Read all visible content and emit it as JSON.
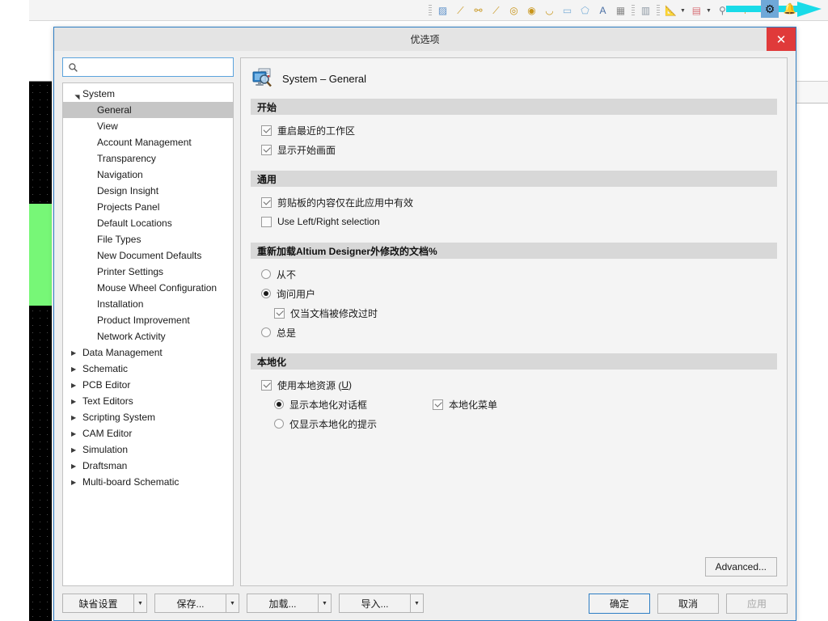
{
  "background": {
    "toolbar_icons": [
      {
        "name": "grip-handle",
        "glyph": ""
      },
      {
        "name": "polygon-pour-icon",
        "glyph": "▨"
      },
      {
        "name": "place-line-icon",
        "glyph": "⟋"
      },
      {
        "name": "place-net-icon",
        "glyph": "⚯"
      },
      {
        "name": "place-route-icon",
        "glyph": "⟋"
      },
      {
        "name": "place-pad-icon",
        "glyph": "◎"
      },
      {
        "name": "place-via-icon",
        "glyph": "◉"
      },
      {
        "name": "place-arc-icon",
        "glyph": "◡"
      },
      {
        "name": "place-rectangle-icon",
        "glyph": "▭"
      },
      {
        "name": "place-polygon-icon",
        "glyph": "⬠"
      },
      {
        "name": "place-string-icon",
        "glyph": "A"
      },
      {
        "name": "place-component-icon",
        "glyph": "▦"
      },
      {
        "name": "grip-handle-2",
        "glyph": ""
      },
      {
        "name": "design-rule-check-icon",
        "glyph": "📐"
      },
      {
        "name": "layer-stack-icon",
        "glyph": "▤"
      },
      {
        "name": "find-similar-icon",
        "glyph": "⚲"
      },
      {
        "name": "dimension-icon",
        "glyph": "⊢"
      },
      {
        "name": "board-planning-icon",
        "glyph": "⧉"
      }
    ],
    "gear_button": "gear-icon",
    "notification_button": "bell-icon",
    "annotation_arrow": "cyan-arrow-pointing-at-gear"
  },
  "dialog": {
    "title": "优选项",
    "close_label": "✕",
    "search": {
      "value": "",
      "placeholder": ""
    },
    "tree": [
      {
        "label": "System",
        "level": 0,
        "twisty": "expanded",
        "selected": false
      },
      {
        "label": "General",
        "level": 1,
        "twisty": "none",
        "selected": true
      },
      {
        "label": "View",
        "level": 1,
        "twisty": "none",
        "selected": false
      },
      {
        "label": "Account Management",
        "level": 1,
        "twisty": "none",
        "selected": false
      },
      {
        "label": "Transparency",
        "level": 1,
        "twisty": "none",
        "selected": false
      },
      {
        "label": "Navigation",
        "level": 1,
        "twisty": "none",
        "selected": false
      },
      {
        "label": "Design Insight",
        "level": 1,
        "twisty": "none",
        "selected": false
      },
      {
        "label": "Projects Panel",
        "level": 1,
        "twisty": "none",
        "selected": false
      },
      {
        "label": "Default Locations",
        "level": 1,
        "twisty": "none",
        "selected": false
      },
      {
        "label": "File Types",
        "level": 1,
        "twisty": "none",
        "selected": false
      },
      {
        "label": "New Document Defaults",
        "level": 1,
        "twisty": "none",
        "selected": false
      },
      {
        "label": "Printer Settings",
        "level": 1,
        "twisty": "none",
        "selected": false
      },
      {
        "label": "Mouse Wheel Configuration",
        "level": 1,
        "twisty": "none",
        "selected": false
      },
      {
        "label": "Installation",
        "level": 1,
        "twisty": "none",
        "selected": false
      },
      {
        "label": "Product Improvement",
        "level": 1,
        "twisty": "none",
        "selected": false
      },
      {
        "label": "Network Activity",
        "level": 1,
        "twisty": "none",
        "selected": false
      },
      {
        "label": "Data Management",
        "level": 0,
        "twisty": "collapsed",
        "selected": false
      },
      {
        "label": "Schematic",
        "level": 0,
        "twisty": "collapsed",
        "selected": false
      },
      {
        "label": "PCB Editor",
        "level": 0,
        "twisty": "collapsed",
        "selected": false
      },
      {
        "label": "Text Editors",
        "level": 0,
        "twisty": "collapsed",
        "selected": false
      },
      {
        "label": "Scripting System",
        "level": 0,
        "twisty": "collapsed",
        "selected": false
      },
      {
        "label": "CAM Editor",
        "level": 0,
        "twisty": "collapsed",
        "selected": false
      },
      {
        "label": "Simulation",
        "level": 0,
        "twisty": "collapsed",
        "selected": false
      },
      {
        "label": "Draftsman",
        "level": 0,
        "twisty": "collapsed",
        "selected": false
      },
      {
        "label": "Multi-board Schematic",
        "level": 0,
        "twisty": "collapsed",
        "selected": false
      }
    ],
    "page": {
      "icon": "system-general-icon",
      "title": "System – General",
      "sections": [
        {
          "header": "开始",
          "options": [
            {
              "type": "checkbox",
              "label": "重启最近的工作区",
              "checked": true,
              "indent": 0
            },
            {
              "type": "checkbox",
              "label": "显示开始画面",
              "checked": true,
              "indent": 0
            }
          ]
        },
        {
          "header": "通用",
          "options": [
            {
              "type": "checkbox",
              "label": "剪贴板的内容仅在此应用中有效",
              "checked": true,
              "indent": 0
            },
            {
              "type": "checkbox",
              "label": "Use Left/Right selection",
              "checked": false,
              "indent": 0
            }
          ]
        },
        {
          "header": "重新加载Altium Designer外修改的文档%",
          "options": [
            {
              "type": "radio",
              "label": "从不",
              "checked": false,
              "indent": 0
            },
            {
              "type": "radio",
              "label": "询问用户",
              "checked": true,
              "indent": 0
            },
            {
              "type": "checkbox",
              "label": "仅当文档被修改过时",
              "checked": true,
              "indent": 1
            },
            {
              "type": "radio",
              "label": "总是",
              "checked": false,
              "indent": 0
            }
          ]
        }
      ],
      "localization": {
        "header": "本地化",
        "use_local_resources": {
          "label_before": "使用本地资源 (",
          "accel": "U",
          "label_after": ")",
          "checked": true
        },
        "show_localized_dialogs": {
          "label": "显示本地化对话框",
          "checked": true
        },
        "localized_menus": {
          "label": "本地化菜单",
          "checked": true
        },
        "show_localized_hints_only": {
          "label": "仅显示本地化的提示",
          "checked": false
        }
      },
      "advanced_label": "Advanced..."
    },
    "footer": {
      "left_buttons": [
        {
          "label": "缺省设置",
          "caret": "▼"
        },
        {
          "label": "保存...",
          "caret": "▼"
        },
        {
          "label": "加载...",
          "caret": "▼"
        },
        {
          "label": "导入...",
          "caret": "▼"
        }
      ],
      "ok_label": "确定",
      "cancel_label": "取消",
      "apply_label": "应用",
      "apply_disabled": true
    }
  }
}
